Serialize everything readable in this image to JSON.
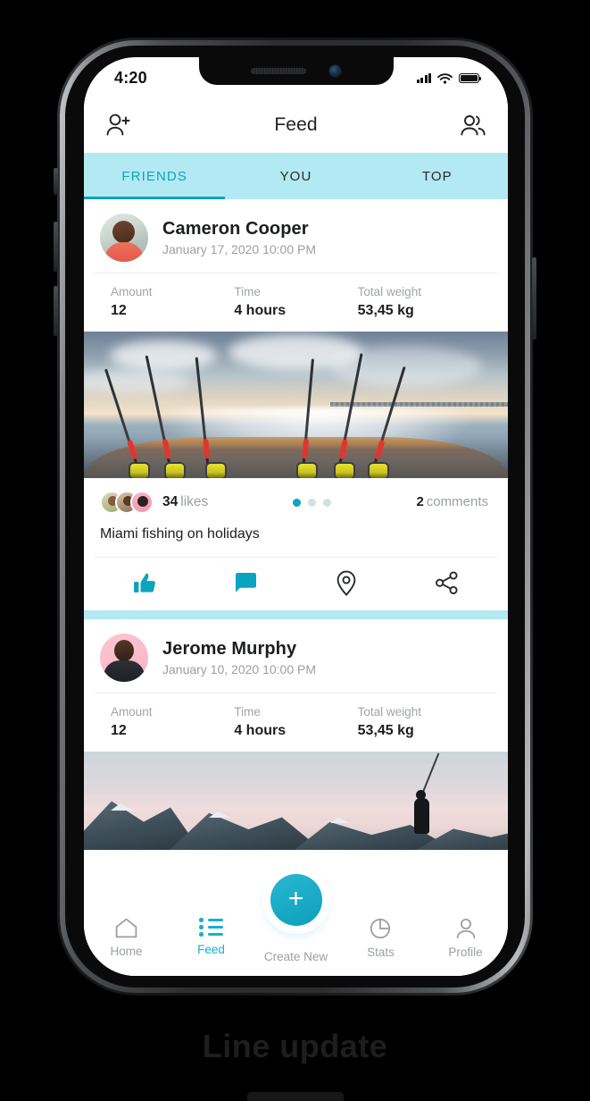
{
  "status_bar": {
    "time": "4:20",
    "signal_icon": "signal-bars-icon",
    "wifi_icon": "wifi-icon",
    "battery_icon": "battery-full-icon"
  },
  "header": {
    "title": "Feed",
    "left_icon": "add-person-icon",
    "right_icon": "friends-icon"
  },
  "tabs": [
    {
      "label": "FRIENDS",
      "active": true
    },
    {
      "label": "YOU",
      "active": false
    },
    {
      "label": "TOP",
      "active": false
    }
  ],
  "posts": [
    {
      "author": "Cameron Cooper",
      "date": "January 17, 2020 10:00 PM",
      "stats": [
        {
          "label": "Amount",
          "value": "12"
        },
        {
          "label": "Time",
          "value": "4 hours"
        },
        {
          "label": "Total weight",
          "value": "53,45 kg"
        }
      ],
      "photo_alt": "fishing-rods-on-boat-at-sunset",
      "likes_count": "34",
      "likes_word": "likes",
      "comments_count": "2",
      "comments_word": "comments",
      "pagination": {
        "total": 3,
        "active_index": 0
      },
      "caption": "Miami fishing on holidays",
      "actions": [
        "like-icon",
        "comment-icon",
        "location-icon",
        "share-icon"
      ]
    },
    {
      "author": "Jerome Murphy",
      "date": "January 10, 2020 10:00 PM",
      "stats": [
        {
          "label": "Amount",
          "value": "12"
        },
        {
          "label": "Time",
          "value": "4 hours"
        },
        {
          "label": "Total weight",
          "value": "53,45 kg"
        }
      ],
      "photo_alt": "fly-fisherman-in-snowy-mountains"
    }
  ],
  "bottom_nav": [
    {
      "label": "Home",
      "icon": "home-icon",
      "active": false
    },
    {
      "label": "Feed",
      "icon": "list-icon",
      "active": true
    },
    {
      "label": "Create New",
      "icon": "plus-icon",
      "active": false
    },
    {
      "label": "Stats",
      "icon": "pie-chart-icon",
      "active": false
    },
    {
      "label": "Profile",
      "icon": "person-icon",
      "active": false
    }
  ],
  "page_caption": "Line update",
  "colors": {
    "accent": "#0ba3bd",
    "accent_light": "#b3e9f2",
    "fab": "#17b0cc",
    "text_primary": "#1b1d1f",
    "text_muted": "#9b9fa3"
  }
}
